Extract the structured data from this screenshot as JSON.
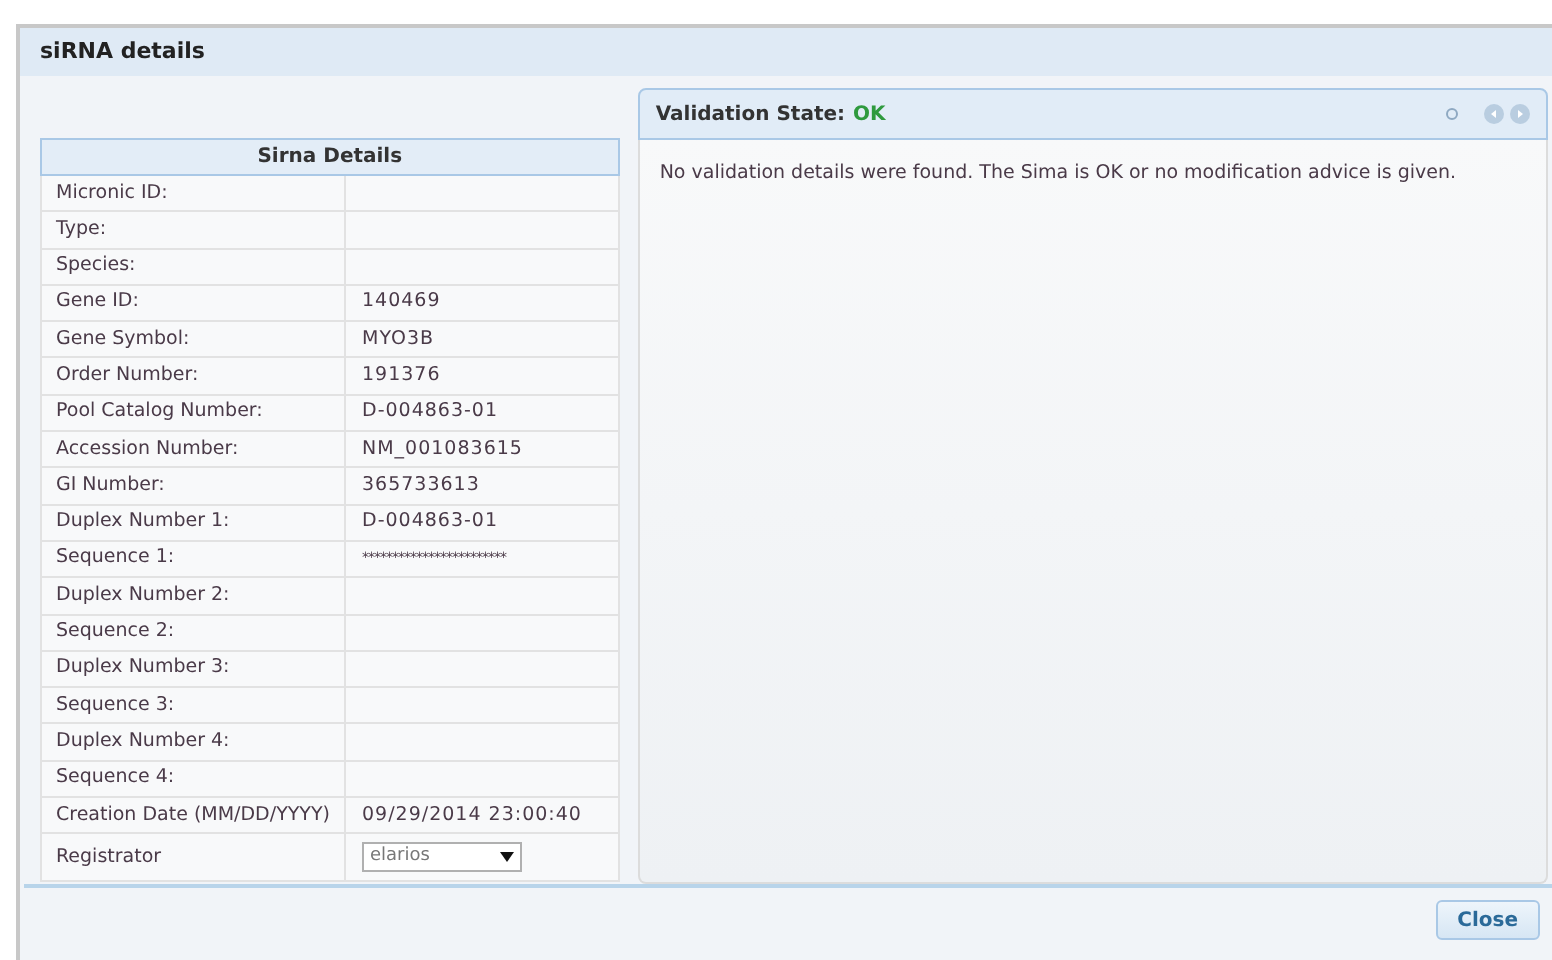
{
  "dialog": {
    "title": "siRNA details"
  },
  "details": {
    "heading": "Sirna Details",
    "rows": [
      {
        "label": "Micronic ID:",
        "value": ""
      },
      {
        "label": "Type:",
        "value": ""
      },
      {
        "label": "Species:",
        "value": ""
      },
      {
        "label": "Gene ID:",
        "value": "140469"
      },
      {
        "label": "Gene Symbol:",
        "value": "MYO3B"
      },
      {
        "label": "Order Number:",
        "value": "191376"
      },
      {
        "label": "Pool Catalog Number:",
        "value": "D-004863-01"
      },
      {
        "label": "Accession Number:",
        "value": "NM_001083615"
      },
      {
        "label": "GI Number:",
        "value": "365733613"
      },
      {
        "label": "Duplex Number 1:",
        "value": "D-004863-01"
      },
      {
        "label": "Sequence 1:",
        "value": "************************",
        "kind": "masked"
      },
      {
        "label": "Duplex Number 2:",
        "value": ""
      },
      {
        "label": "Sequence 2:",
        "value": ""
      },
      {
        "label": "Duplex Number 3:",
        "value": ""
      },
      {
        "label": "Sequence 3:",
        "value": ""
      },
      {
        "label": "Duplex Number 4:",
        "value": ""
      },
      {
        "label": "Sequence 4:",
        "value": ""
      },
      {
        "label": "Creation Date (MM/DD/YYYY)",
        "value": "09/29/2014 23:00:40"
      },
      {
        "label": "Registrator",
        "value": "elarios",
        "kind": "select"
      }
    ]
  },
  "validation": {
    "label": "Validation State:",
    "state": "OK",
    "message": "No validation details were found. The Sima is OK or no modification advice is given."
  },
  "buttons": [
    "Close"
  ]
}
